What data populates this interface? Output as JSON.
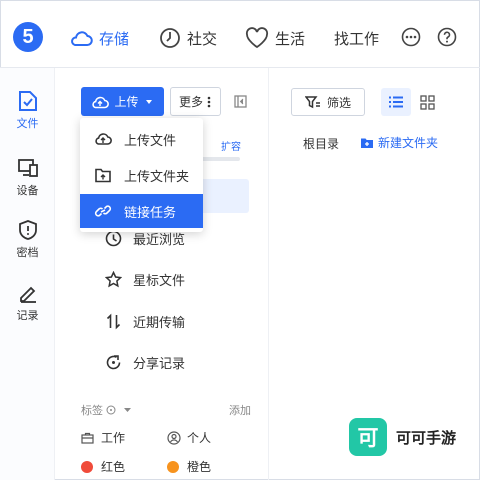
{
  "topbar": {
    "logo_text": "5",
    "nav": [
      {
        "label": "存储",
        "icon": "cloud-icon",
        "active": true
      },
      {
        "label": "社交",
        "icon": "clock-icon",
        "active": false
      },
      {
        "label": "生活",
        "icon": "heart-icon",
        "active": false
      },
      {
        "label": "找工作",
        "icon": "",
        "active": false
      }
    ],
    "right_icons": [
      "more-icon",
      "help-icon"
    ]
  },
  "rail": {
    "items": [
      {
        "label": "文件",
        "icon": "file-icon",
        "active": true
      },
      {
        "label": "设备",
        "icon": "device-icon",
        "active": false
      },
      {
        "label": "密档",
        "icon": "shield-icon",
        "active": false
      },
      {
        "label": "记录",
        "icon": "pen-icon",
        "active": false
      }
    ]
  },
  "toolbar": {
    "upload_label": "上传",
    "more_label": "更多",
    "expand_label": "扩容"
  },
  "upload_menu": {
    "items": [
      {
        "label": "上传文件",
        "icon": "upload-file-icon",
        "active": false
      },
      {
        "label": "上传文件夹",
        "icon": "upload-folder-icon",
        "active": false
      },
      {
        "label": "链接任务",
        "icon": "link-icon",
        "active": true
      }
    ]
  },
  "side_menu": {
    "items": [
      {
        "label": "最近浏览",
        "icon": "recent-icon"
      },
      {
        "label": "星标文件",
        "icon": "star-icon"
      },
      {
        "label": "近期传输",
        "icon": "transfer-icon"
      },
      {
        "label": "分享记录",
        "icon": "share-icon"
      }
    ]
  },
  "tags": {
    "header": "标签",
    "add_label": "添加",
    "items": [
      {
        "label": "工作",
        "icon": "briefcase-icon",
        "color": ""
      },
      {
        "label": "个人",
        "icon": "person-icon",
        "color": ""
      },
      {
        "label": "红色",
        "icon": "",
        "color": "#f04b3a"
      },
      {
        "label": "橙色",
        "icon": "",
        "color": "#f7931e"
      }
    ]
  },
  "right_panel": {
    "filter_label": "筛选",
    "root_label": "根目录",
    "new_folder_label": "新建文件夹"
  },
  "watermark": {
    "logo_text": "可",
    "text": "可可手游"
  },
  "colors": {
    "accent": "#2b6bf3",
    "watermark": "#22c7a6"
  }
}
